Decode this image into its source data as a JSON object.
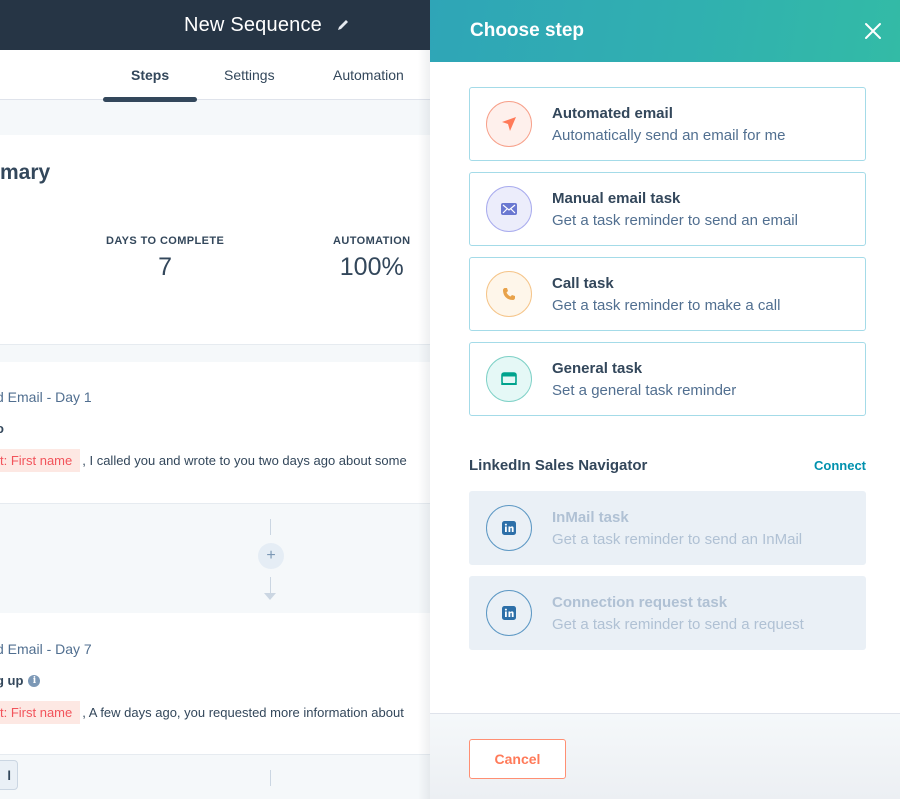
{
  "header": {
    "title": "New Sequence",
    "edit_icon": "pencil-icon"
  },
  "tabs": [
    {
      "label": "Steps",
      "active": true
    },
    {
      "label": "Settings",
      "active": false
    },
    {
      "label": "Automation",
      "active": false
    }
  ],
  "summary": {
    "heading": "Summary",
    "heading_visible": "mary",
    "stats": [
      {
        "label": "DAYS TO COMPLETE",
        "value": "7"
      },
      {
        "label": "AUTOMATION",
        "value": "100%"
      }
    ]
  },
  "steps": [
    {
      "title": "d Email - Day 1",
      "subject": "o",
      "token": "t: First name",
      "body": ", I called you and wrote to you two days ago about some"
    },
    {
      "title": "d Email - Day 7",
      "subject": "g up",
      "token": "t: First name",
      "body": ", A few days ago, you requested more information about"
    }
  ],
  "connector": {
    "add_label": "+"
  },
  "left_button_label": "l",
  "panel": {
    "title": "Choose step",
    "close_icon": "close-icon",
    "options": [
      {
        "title": "Automated email",
        "description": "Automatically send an email for me",
        "icon": "paper-plane-icon",
        "color": "#ff7a59",
        "enabled": true
      },
      {
        "title": "Manual email task",
        "description": "Get a task reminder to send an email",
        "icon": "envelope-icon",
        "color": "#6a78d1",
        "enabled": true
      },
      {
        "title": "Call task",
        "description": "Get a task reminder to make a call",
        "icon": "phone-icon",
        "color": "#f5a623",
        "enabled": true
      },
      {
        "title": "General task",
        "description": "Set a general task reminder",
        "icon": "task-icon",
        "color": "#00bda5",
        "enabled": true
      }
    ],
    "linkedin_section": {
      "label": "LinkedIn Sales Navigator",
      "connect_label": "Connect",
      "options": [
        {
          "title": "InMail task",
          "description": "Get a task reminder to send an InMail",
          "icon": "linkedin-icon",
          "enabled": false
        },
        {
          "title": "Connection request task",
          "description": "Get a task reminder to send a request",
          "icon": "linkedin-icon",
          "enabled": false
        }
      ]
    },
    "cancel_label": "Cancel"
  },
  "colors": {
    "topbar": "#263545",
    "accent_teal": "#00a4bd",
    "cancel_orange": "#ff7a59",
    "link": "#0091ae",
    "text": "#33475b"
  }
}
